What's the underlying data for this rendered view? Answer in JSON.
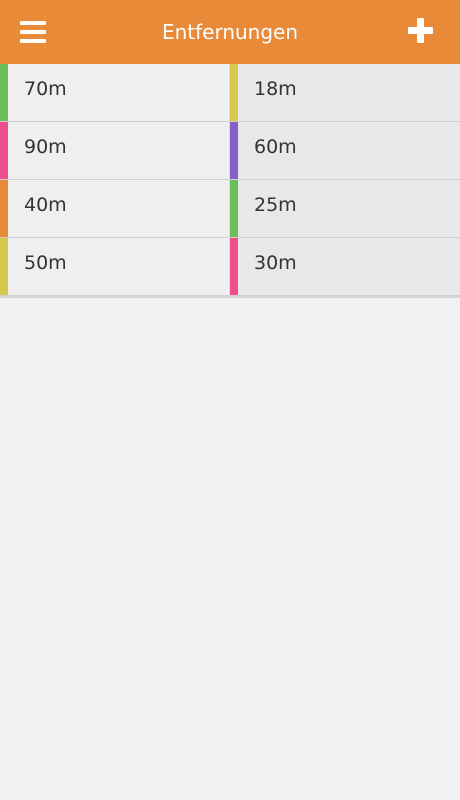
{
  "header": {
    "title": "Entfernungen",
    "background": "#e88a38",
    "left_icon": "menu-icon",
    "right_icon": "plus-icon"
  },
  "distances": [
    {
      "label": "70m",
      "color": "#6abf5a"
    },
    {
      "label": "18m",
      "color": "#d6c84a"
    },
    {
      "label": "90m",
      "color": "#ee4f8c"
    },
    {
      "label": "60m",
      "color": "#8460c8"
    },
    {
      "label": "40m",
      "color": "#e88a38"
    },
    {
      "label": "25m",
      "color": "#6abf5a"
    },
    {
      "label": "50m",
      "color": "#d6c84a"
    },
    {
      "label": "30m",
      "color": "#ee4f8c"
    }
  ]
}
